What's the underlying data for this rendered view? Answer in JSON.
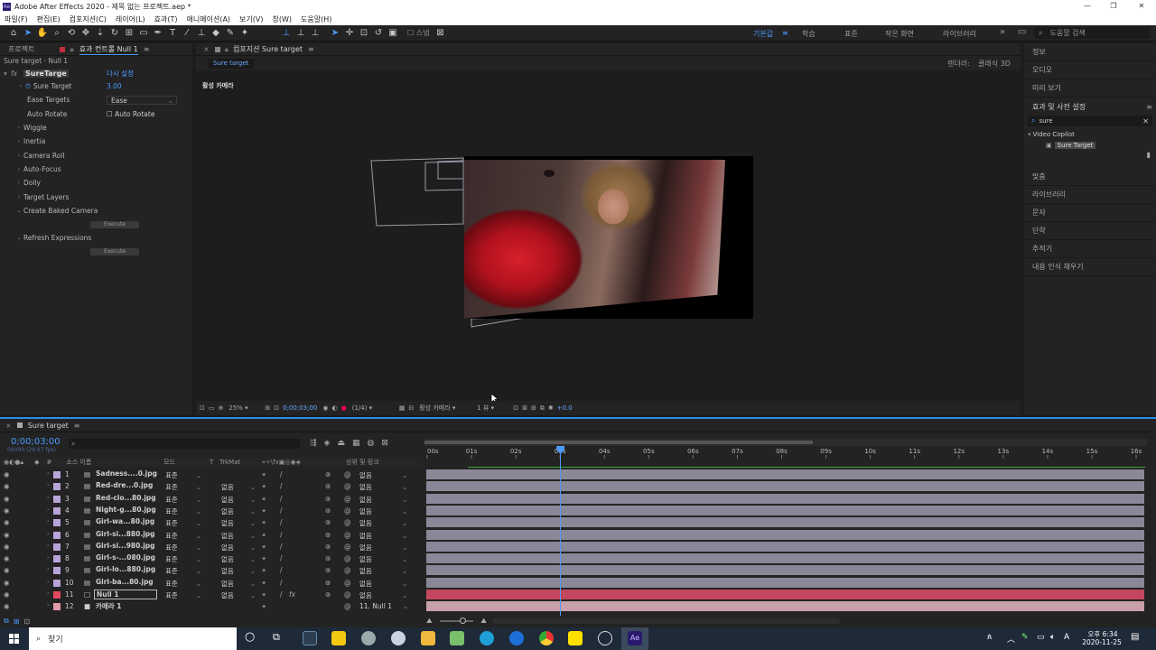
{
  "window": {
    "title": "Adobe After Effects 2020 - 제목 없는 프로젝트.aep *",
    "app_icon": "Ae",
    "minimize": "—",
    "restore": "❐",
    "close": "✕"
  },
  "menu": [
    "파일(F)",
    "편집(E)",
    "컴포지션(C)",
    "레이어(L)",
    "효과(T)",
    "애니메이션(A)",
    "보기(V)",
    "창(W)",
    "도움말(H)"
  ],
  "toolbar": {
    "snap_label": "스냅",
    "workspaces": [
      "기본값",
      "학습",
      "표준",
      "작은 화면",
      "라이브러리"
    ],
    "active_workspace": "기본값",
    "search_placeholder": "도움말 검색"
  },
  "left_panel": {
    "tabs": [
      "프로젝트",
      "효과 컨트롤 Null 1"
    ],
    "layer_path": "Sure target · Null 1",
    "effect_name": "SureTarge",
    "reset_label": "다시 설정",
    "params": [
      {
        "label": "Sure Target",
        "value": "3.00",
        "kind": "value"
      },
      {
        "label": "Ease Targets",
        "value": "Ease",
        "kind": "dropdown"
      },
      {
        "label": "Auto Rotate",
        "value": "Auto Rotate",
        "kind": "checkbox"
      },
      {
        "label": "Wiggle",
        "kind": "group"
      },
      {
        "label": "Inertia",
        "kind": "group"
      },
      {
        "label": "Camera Roll",
        "kind": "group"
      },
      {
        "label": "Auto-Focus",
        "kind": "group"
      },
      {
        "label": "Dolly",
        "kind": "group"
      },
      {
        "label": "Target Layers",
        "kind": "group"
      },
      {
        "label": "Create Baked Camera",
        "kind": "open"
      },
      {
        "label": "Refresh Expressions",
        "kind": "open"
      }
    ],
    "execute_label": "Execute"
  },
  "viewer": {
    "tab_label": "컴포지션 Sure target",
    "comp_chip": "Sure target",
    "camera_label": "활성 카메라",
    "renderer": "렌더러:",
    "renderer_value": "클래식 3D",
    "zoom": "25%",
    "timecode": "0;00;03;00",
    "resolution": "(1/4)",
    "view_mode": "활성 카메라",
    "views": "1 뷰",
    "exposure": "+0.0"
  },
  "right_panel": {
    "items_top": [
      "정보",
      "오디오",
      "미리 보기"
    ],
    "effects_title": "효과 및 사전 설정",
    "search_value": "sure",
    "tree_folder": "Video Copilot",
    "tree_item": "Sure Target",
    "items_bottom": [
      "맞춤",
      "라이브러리",
      "문자",
      "단락",
      "추적기",
      "내용 인식 채우기"
    ]
  },
  "timeline": {
    "tab_label": "Sure target",
    "timecode": "0;00;03;00",
    "fps": "00090 (29.97 fps)",
    "col_source": "소스 이름",
    "col_mode": "모드",
    "col_trkmat": "TrkMat",
    "col_parent": "상위 및 링크",
    "ruler": [
      "00s",
      "01s",
      "02s",
      "03s",
      "04s",
      "05s",
      "06s",
      "07s",
      "08s",
      "09s",
      "10s",
      "11s",
      "12s",
      "13s",
      "14s",
      "15s",
      "16s"
    ],
    "playhead_sec": 3,
    "duration_sec": 16,
    "mode_value": "표준",
    "trkmat_value": "없음",
    "parent_value": "없음",
    "layers": [
      {
        "n": "1",
        "name": "Sadness....0.jpg",
        "color": "#b9a4d8"
      },
      {
        "n": "2",
        "name": "Red-dre...0.jpg",
        "color": "#b9a4d8"
      },
      {
        "n": "3",
        "name": "Red-clo...80.jpg",
        "color": "#b9a4d8"
      },
      {
        "n": "4",
        "name": "Night-g...80.jpg",
        "color": "#b9a4d8"
      },
      {
        "n": "5",
        "name": "Girl-wa...80.jpg",
        "color": "#b9a4d8"
      },
      {
        "n": "6",
        "name": "Girl-si...880.jpg",
        "color": "#b9a4d8"
      },
      {
        "n": "7",
        "name": "Girl-si...980.jpg",
        "color": "#b9a4d8"
      },
      {
        "n": "8",
        "name": "Girl-s-...080.jpg",
        "color": "#b9a4d8"
      },
      {
        "n": "9",
        "name": "Girl-lo...880.jpg",
        "color": "#b9a4d8"
      },
      {
        "n": "10",
        "name": "Girl-ba...80.jpg",
        "color": "#b9a4d8"
      },
      {
        "n": "11",
        "name": "Null 1",
        "color": "#e0495f",
        "selected": true
      },
      {
        "n": "12",
        "name": "카메라 1",
        "color": "#e09aa8",
        "parent": "11. Null 1"
      }
    ]
  },
  "taskbar": {
    "search_placeholder": "찾기",
    "time": "오후 6:34",
    "date": "2020-11-25",
    "input_lang": "A"
  }
}
